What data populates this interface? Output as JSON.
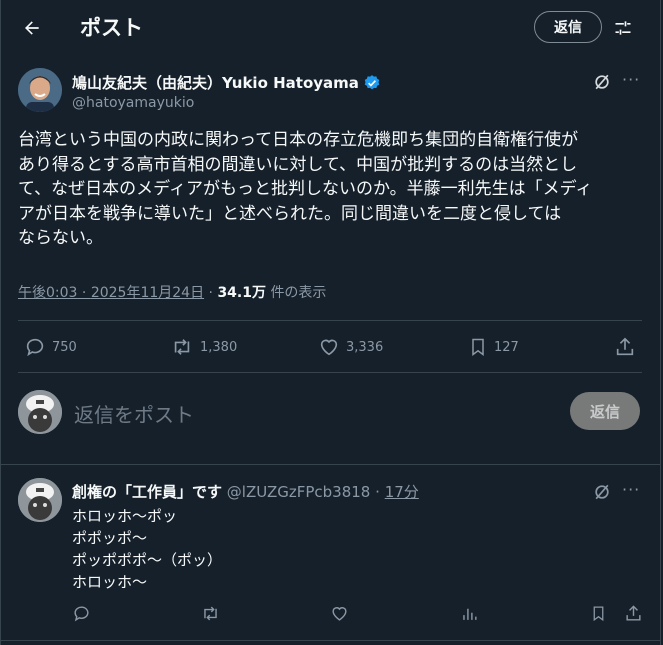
{
  "header": {
    "title": "ポスト",
    "reply_label": "返信"
  },
  "post": {
    "display_name": "鳩山友紀夫（由紀夫）Yukio Hatoyama",
    "handle": "@hatoyamayukio",
    "body": "台湾という中国の内政に関わって日本の存立危機即ち集団的自衛権行使が\nあり得るとする高市首相の間違いに対して、中国が批判するのは当然とし\nて、なぜ日本のメディアがもっと批判しないのか。半藤一利先生は「メディ\nアが日本を戦争に導いた」と述べられた。同じ間違いを二度と侵しては\nならない。",
    "time": "午後0:03",
    "date": "2025年11月24日",
    "views": "34.1万",
    "views_label": "件の表示",
    "replies": "750",
    "reposts": "1,380",
    "likes": "3,336",
    "bookmarks": "127"
  },
  "composer": {
    "placeholder": "返信をポスト",
    "button_label": "返信"
  },
  "reply": {
    "display_name": "創権の「工作員」です",
    "handle": "@lZUZGzFPcb3818",
    "separator": "·",
    "time": "17分",
    "body": "ホロッホ〜ポッ\nポポッポ〜\nポッポポポ〜（ポッ）\nホロッホ〜"
  },
  "colors": {
    "background": "#15202b",
    "text": "#f7f9f9",
    "muted": "#8b98a5",
    "verified": "#1d9bf0",
    "divider": "#38444d"
  },
  "icons": [
    "back-arrow-icon",
    "filter-icon",
    "verified-badge-icon",
    "grok-icon",
    "more-icon",
    "reply-icon",
    "repost-icon",
    "like-icon",
    "bookmark-icon",
    "share-icon",
    "analytics-icon"
  ]
}
